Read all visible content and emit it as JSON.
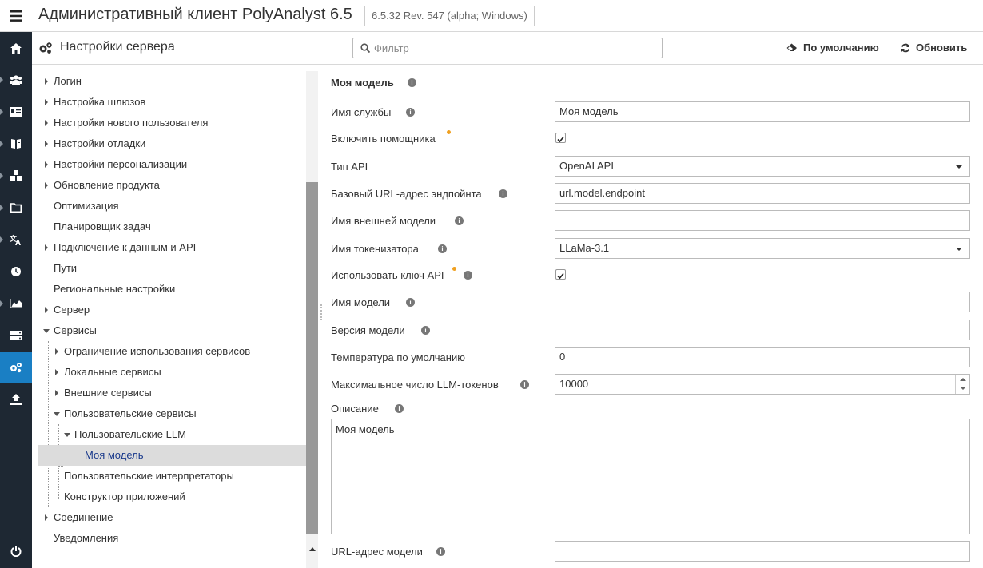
{
  "app": {
    "title": "Административный клиент PolyAnalyst 6.5",
    "version": "6.5.32 Rev. 547 (alpha; Windows)"
  },
  "nav": {
    "icons": [
      "home-icon",
      "users-icon",
      "id-card-icon",
      "book-icon",
      "cubes-icon",
      "folder-icon",
      "translate-icon",
      "clock-icon",
      "chart-icon",
      "server-icon",
      "gears-icon",
      "upload-icon",
      "power-icon"
    ],
    "active": "gears-icon"
  },
  "header": {
    "title": "Настройки сервера",
    "filter_placeholder": "Фильтр",
    "default_label": "По умолчанию",
    "refresh_label": "Обновить"
  },
  "tree": [
    {
      "label": "Логин",
      "state": "closed",
      "level": 0
    },
    {
      "label": "Настройка шлюзов",
      "state": "closed",
      "level": 0
    },
    {
      "label": "Настройки нового пользователя",
      "state": "closed",
      "level": 0
    },
    {
      "label": "Настройки отладки",
      "state": "closed",
      "level": 0
    },
    {
      "label": "Настройки персонализации",
      "state": "closed",
      "level": 0
    },
    {
      "label": "Обновление продукта",
      "state": "closed",
      "level": 0
    },
    {
      "label": "Оптимизация",
      "state": "leaf",
      "level": 0
    },
    {
      "label": "Планировщик задач",
      "state": "leaf",
      "level": 0
    },
    {
      "label": "Подключение к данным и API",
      "state": "closed",
      "level": 0
    },
    {
      "label": "Пути",
      "state": "leaf",
      "level": 0
    },
    {
      "label": "Региональные настройки",
      "state": "leaf",
      "level": 0
    },
    {
      "label": "Сервер",
      "state": "closed",
      "level": 0
    },
    {
      "label": "Сервисы",
      "state": "open",
      "level": 0
    },
    {
      "label": "Ограничение использования сервисов",
      "state": "closed",
      "level": 1
    },
    {
      "label": "Локальные сервисы",
      "state": "closed",
      "level": 1
    },
    {
      "label": "Внешние сервисы",
      "state": "closed",
      "level": 1
    },
    {
      "label": "Пользовательские сервисы",
      "state": "open",
      "level": 1
    },
    {
      "label": "Пользовательские LLM",
      "state": "open",
      "level": 2
    },
    {
      "label": "Моя модель",
      "state": "leaf",
      "level": 3,
      "selected": true
    },
    {
      "label": "Пользовательские интерпретаторы",
      "state": "leaf",
      "level": 1
    },
    {
      "label": "Конструктор приложений",
      "state": "leaf",
      "level": 1
    },
    {
      "label": "Соединение",
      "state": "closed",
      "level": 0
    },
    {
      "label": "Уведомления",
      "state": "leaf",
      "level": 0
    }
  ],
  "form": {
    "title": "Моя модель",
    "fields": {
      "service_name": {
        "label": "Имя службы",
        "value": "Моя модель"
      },
      "enable_assistant": {
        "label": "Включить помощника",
        "checked": true
      },
      "api_type": {
        "label": "Тип API",
        "value": "OpenAI API"
      },
      "base_url": {
        "label": "Базовый URL-адрес эндпойнта",
        "value": "url.model.endpoint"
      },
      "external_model": {
        "label": "Имя внешней модели",
        "value": ""
      },
      "tokenizer": {
        "label": "Имя токенизатора",
        "value": "LLaMa-3.1"
      },
      "use_api_key": {
        "label": "Использовать ключ API",
        "checked": true
      },
      "model_name": {
        "label": "Имя модели",
        "value": ""
      },
      "model_version": {
        "label": "Версия модели",
        "value": ""
      },
      "temperature": {
        "label": "Температура по умолчанию",
        "value": "0"
      },
      "max_tokens": {
        "label": "Максимальное число LLM-токенов",
        "value": "10000"
      },
      "description": {
        "label": "Описание",
        "value": "Моя модель"
      },
      "model_url": {
        "label": "URL-адрес модели",
        "value": ""
      }
    }
  },
  "colors": {
    "sidebar": "#1e2833",
    "active_nav": "#1a7fc4",
    "selected_tree": "#dcdcdc",
    "modified_dot": "#f0a020"
  }
}
